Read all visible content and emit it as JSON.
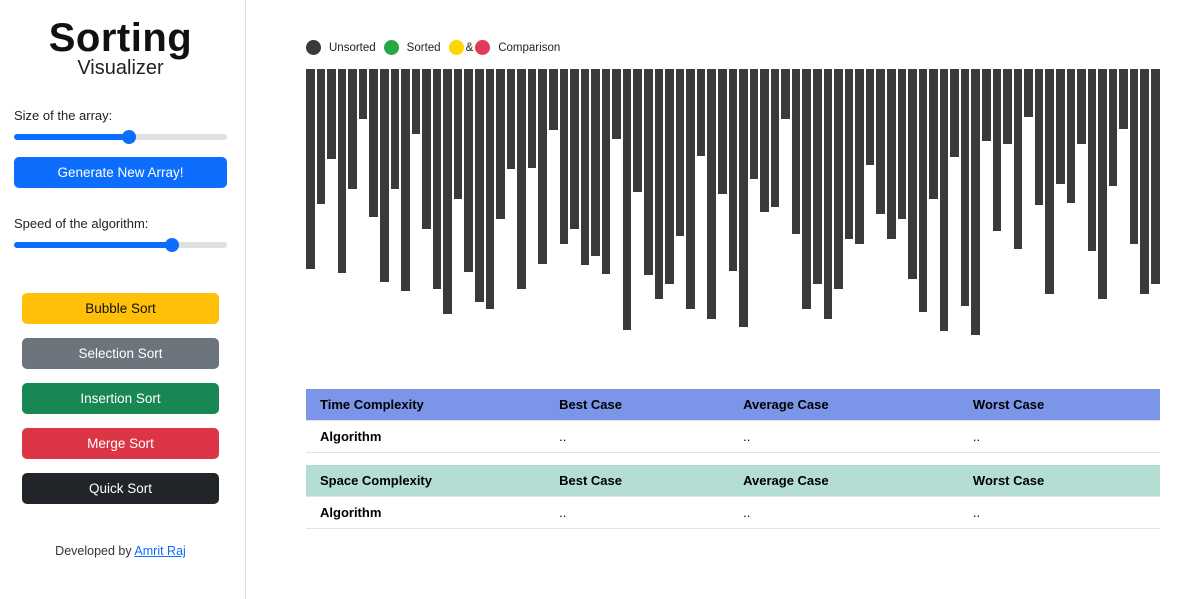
{
  "title": {
    "line1": "Sorting",
    "line2": "Visualizer"
  },
  "labels": {
    "size": "Size of the array:",
    "speed": "Speed of the algorithm:",
    "generate": "Generate New Array!"
  },
  "sliders": {
    "size_pct": 54,
    "speed_pct": 74
  },
  "sorts": {
    "bubble": "Bubble Sort",
    "selection": "Selection Sort",
    "insertion": "Insertion Sort",
    "merge": "Merge Sort",
    "quick": "Quick Sort"
  },
  "credit": {
    "prefix": "Developed by ",
    "name": "Amrit Raj"
  },
  "legend": {
    "unsorted": "Unsorted",
    "sorted": "Sorted",
    "amp": "&",
    "comparison": "Comparison"
  },
  "chart_data": {
    "type": "bar",
    "title": "Unsorted array visualization",
    "xlabel": "",
    "ylabel": "",
    "ylim": [
      0,
      280
    ],
    "values": [
      200,
      135,
      90,
      204,
      120,
      50,
      148,
      213,
      120,
      222,
      65,
      160,
      220,
      245,
      130,
      203,
      233,
      240,
      150,
      100,
      220,
      99,
      195,
      61,
      175,
      160,
      196,
      187,
      205,
      70,
      261,
      123,
      206,
      230,
      215,
      167,
      240,
      87,
      250,
      125,
      202,
      258,
      110,
      143,
      138,
      50,
      165,
      240,
      215,
      250,
      220,
      170,
      175,
      96,
      145,
      170,
      150,
      210,
      243,
      130,
      262,
      88,
      237,
      266,
      72,
      162,
      75,
      180,
      48,
      136,
      225,
      115,
      134,
      75,
      182,
      230,
      117,
      60,
      175,
      225,
      215
    ]
  },
  "tables": {
    "time": {
      "header": [
        "Time Complexity",
        "Best Case",
        "Average Case",
        "Worst Case"
      ],
      "row": [
        "Algorithm",
        "..",
        "..",
        ".."
      ]
    },
    "space": {
      "header": [
        "Space Complexity",
        "Best Case",
        "Average Case",
        "Worst Case"
      ],
      "row": [
        "Algorithm",
        "..",
        "..",
        ".."
      ]
    }
  }
}
